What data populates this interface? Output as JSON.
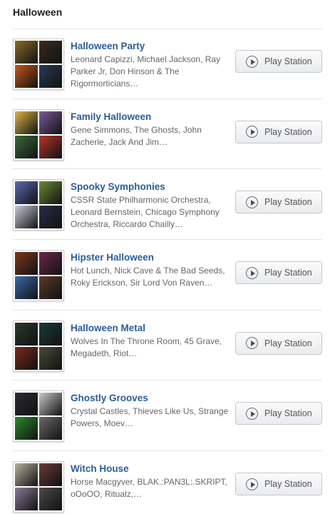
{
  "section": {
    "title": "Halloween"
  },
  "play_label": "Play Station",
  "stations": [
    {
      "name": "Halloween Party",
      "artists": "Leonard Capizzi, Michael Jackson, Ray Parker Jr, Don Hinson & The Rigormorticians…",
      "art_colors": [
        "#8a6a2a",
        "#3a2c1e",
        "#c4581a",
        "#2a3a5a"
      ]
    },
    {
      "name": "Family Halloween",
      "artists": "Gene Simmons, The Ghosts, John Zacherle, Jack And Jim…",
      "art_colors": [
        "#d9b54a",
        "#7a5a9a",
        "#3a6a3a",
        "#b9342a"
      ]
    },
    {
      "name": "Spooky Symphonies",
      "artists": "CSSR State Philharmonic Orchestra, Leonard Bernstein, Chicago Symphony Orchestra, Riccardo Chailly…",
      "art_colors": [
        "#5a6ab0",
        "#6a8a3a",
        "#c8ccd8",
        "#2a2e4a"
      ]
    },
    {
      "name": "Hipster Halloween",
      "artists": "Hot Lunch, Nick Cave & The Bad Seeds, Roky Erickson, Sir Lord Von Raven…",
      "art_colors": [
        "#7a3a1a",
        "#6a2a4a",
        "#3a6aaa",
        "#5a3a2a"
      ]
    },
    {
      "name": "Halloween Metal",
      "artists": "Wolves In The Throne Room, 45 Grave, Megadeth, Riot…",
      "art_colors": [
        "#2a3a2a",
        "#1a3a3a",
        "#7a2a1a",
        "#4a4a3a"
      ]
    },
    {
      "name": "Ghostly Grooves",
      "artists": "Crystal Castles, Thieves Like Us, Strange Powers, Moev…",
      "art_colors": [
        "#2a2a3a",
        "#c8c8c8",
        "#2a8a2a",
        "#6a6a6a"
      ]
    },
    {
      "name": "Witch House",
      "artists": "Horse Macgyver, BLAK.:PAN3L:.SKRIPT, oOoOO, Ritualz,…",
      "art_colors": [
        "#b8b0a0",
        "#6a3a3a",
        "#8a7a9a",
        "#4a4a4a"
      ]
    }
  ]
}
